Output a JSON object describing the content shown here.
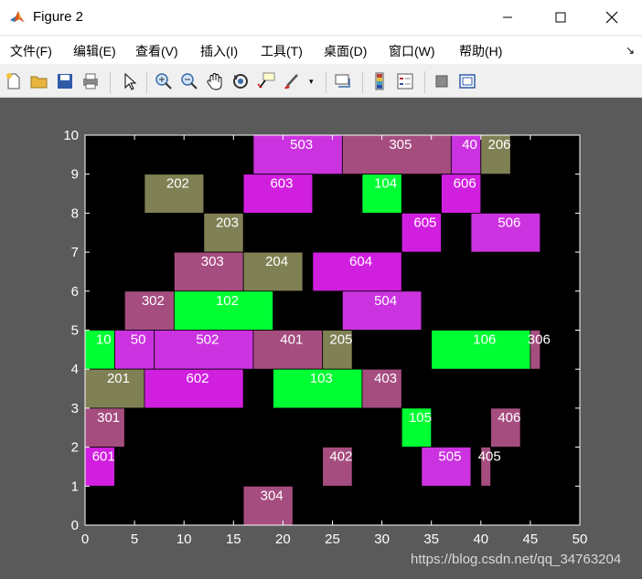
{
  "window": {
    "title": "Figure 2",
    "controls": {
      "minimize": "—",
      "maximize": "☐",
      "close": "✕"
    }
  },
  "menu": {
    "items": [
      "文件(F)",
      "编辑(E)",
      "查看(V)",
      "插入(I)",
      "工具(T)",
      "桌面(D)",
      "窗口(W)",
      "帮助(H)"
    ],
    "overflow_icon": "arrow-down-right-icon"
  },
  "toolbar": {
    "icons": [
      "new-figure-icon",
      "open-icon",
      "save-icon",
      "print-icon",
      "pointer-icon",
      "zoom-in-icon",
      "zoom-out-icon",
      "pan-icon",
      "rotate-icon",
      "data-cursor-icon",
      "brush-icon",
      "link-plot-icon",
      "colorbar-icon",
      "legend-icon",
      "hide-plot-tools-icon",
      "show-plot-tools-icon"
    ]
  },
  "watermark": "https://blog.csdn.net/qq_34763204",
  "colors": {
    "figure_bg": "#5a5a5a",
    "axes_bg": "#000000",
    "axis_color": "#ffffff",
    "green": "#00ff33",
    "olive": "#808055",
    "mauve": "#a64d80",
    "magenta": "#d11fe0",
    "orchid": "#cc33e0"
  },
  "chart_data": {
    "type": "rectangles",
    "xlim": [
      0,
      50
    ],
    "ylim": [
      0,
      10
    ],
    "xticks": [
      "0",
      "5",
      "10",
      "15",
      "20",
      "25",
      "30",
      "35",
      "40",
      "45",
      "50"
    ],
    "yticks": [
      "0",
      "1",
      "2",
      "3",
      "4",
      "5",
      "6",
      "7",
      "8",
      "9",
      "10"
    ],
    "rects": [
      {
        "label": "503",
        "x": 17,
        "y": 9,
        "w": 9,
        "h": 1,
        "color": "#cc33e0"
      },
      {
        "label": "305",
        "x": 26,
        "y": 9,
        "w": 11,
        "h": 1,
        "color": "#a64d80"
      },
      {
        "label": "40",
        "x": 37,
        "y": 9,
        "w": 3,
        "h": 1,
        "color": "#cc33e0"
      },
      {
        "label": "206",
        "x": 40,
        "y": 9,
        "w": 3,
        "h": 1,
        "color": "#808055"
      },
      {
        "label": "202",
        "x": 6,
        "y": 8,
        "w": 6,
        "h": 1,
        "color": "#808055"
      },
      {
        "label": "603",
        "x": 16,
        "y": 8,
        "w": 7,
        "h": 1,
        "color": "#d11fe0"
      },
      {
        "label": "104",
        "x": 28,
        "y": 8,
        "w": 4,
        "h": 1,
        "color": "#00ff33"
      },
      {
        "label": "606",
        "x": 36,
        "y": 8,
        "w": 4,
        "h": 1,
        "color": "#d11fe0"
      },
      {
        "label": "203",
        "x": 12,
        "y": 7,
        "w": 4,
        "h": 1,
        "color": "#808055"
      },
      {
        "label": "605",
        "x": 32,
        "y": 7,
        "w": 4,
        "h": 1,
        "color": "#d11fe0"
      },
      {
        "label": "506",
        "x": 39,
        "y": 7,
        "w": 7,
        "h": 1,
        "color": "#cc33e0"
      },
      {
        "label": "303",
        "x": 9,
        "y": 6,
        "w": 7,
        "h": 1,
        "color": "#a64d80"
      },
      {
        "label": "204",
        "x": 16,
        "y": 6,
        "w": 6,
        "h": 1,
        "color": "#808055"
      },
      {
        "label": "604",
        "x": 23,
        "y": 6,
        "w": 9,
        "h": 1,
        "color": "#d11fe0"
      },
      {
        "label": "302",
        "x": 4,
        "y": 5,
        "w": 5,
        "h": 1,
        "color": "#a64d80"
      },
      {
        "label": "102",
        "x": 9,
        "y": 5,
        "w": 10,
        "h": 1,
        "color": "#00ff33"
      },
      {
        "label": "504",
        "x": 26,
        "y": 5,
        "w": 8,
        "h": 1,
        "color": "#cc33e0"
      },
      {
        "label": "10",
        "x": 0,
        "y": 4,
        "w": 3,
        "h": 1,
        "color": "#00ff33"
      },
      {
        "label": "50",
        "x": 3,
        "y": 4,
        "w": 4,
        "h": 1,
        "color": "#cc33e0"
      },
      {
        "label": "502",
        "x": 7,
        "y": 4,
        "w": 10,
        "h": 1,
        "color": "#cc33e0"
      },
      {
        "label": "401",
        "x": 17,
        "y": 4,
        "w": 7,
        "h": 1,
        "color": "#a64d80"
      },
      {
        "label": "205",
        "x": 24,
        "y": 4,
        "w": 3,
        "h": 1,
        "color": "#808055"
      },
      {
        "label": "106",
        "x": 35,
        "y": 4,
        "w": 10,
        "h": 1,
        "color": "#00ff33"
      },
      {
        "label": "306",
        "x": 45,
        "y": 4,
        "w": 1,
        "h": 1,
        "color": "#a64d80"
      },
      {
        "label": "201",
        "x": 0,
        "y": 3,
        "w": 6,
        "h": 1,
        "color": "#808055"
      },
      {
        "label": "602",
        "x": 6,
        "y": 3,
        "w": 10,
        "h": 1,
        "color": "#d11fe0"
      },
      {
        "label": "103",
        "x": 19,
        "y": 3,
        "w": 9,
        "h": 1,
        "color": "#00ff33"
      },
      {
        "label": "403",
        "x": 28,
        "y": 3,
        "w": 4,
        "h": 1,
        "color": "#a64d80"
      },
      {
        "label": "301",
        "x": 0,
        "y": 2,
        "w": 4,
        "h": 1,
        "color": "#a64d80"
      },
      {
        "label": "105",
        "x": 32,
        "y": 2,
        "w": 3,
        "h": 1,
        "color": "#00ff33"
      },
      {
        "label": "406",
        "x": 41,
        "y": 2,
        "w": 3,
        "h": 1,
        "color": "#a64d80"
      },
      {
        "label": "601",
        "x": 0,
        "y": 1,
        "w": 3,
        "h": 1,
        "color": "#d11fe0"
      },
      {
        "label": "402",
        "x": 24,
        "y": 1,
        "w": 3,
        "h": 1,
        "color": "#a64d80"
      },
      {
        "label": "505",
        "x": 34,
        "y": 1,
        "w": 5,
        "h": 1,
        "color": "#cc33e0"
      },
      {
        "label": "405",
        "x": 40,
        "y": 1,
        "w": 1,
        "h": 1,
        "color": "#a64d80"
      },
      {
        "label": "304",
        "x": 16,
        "y": 0,
        "w": 5,
        "h": 1,
        "color": "#a64d80"
      }
    ]
  }
}
